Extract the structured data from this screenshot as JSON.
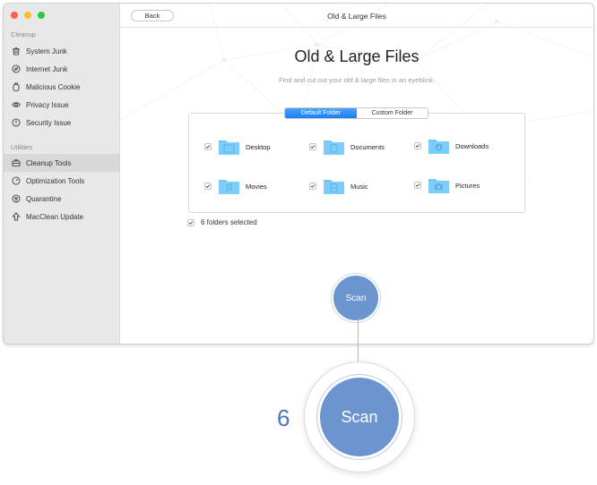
{
  "window": {
    "title": "Old & Large Files",
    "back_label": "Back"
  },
  "sidebar": {
    "sections": [
      {
        "label": "Cleanup",
        "items": [
          {
            "label": "System Junk",
            "icon": "trash-icon"
          },
          {
            "label": "Internet Junk",
            "icon": "compass-icon"
          },
          {
            "label": "Malicious Cookie",
            "icon": "cookie-jar-icon"
          },
          {
            "label": "Privacy Issue",
            "icon": "eye-icon"
          },
          {
            "label": "Security Issue",
            "icon": "shield-icon"
          }
        ]
      },
      {
        "label": "Utilities",
        "items": [
          {
            "label": "Cleanup Tools",
            "icon": "briefcase-icon",
            "active": true
          },
          {
            "label": "Optimization Tools",
            "icon": "gauge-icon"
          },
          {
            "label": "Quarantine",
            "icon": "biohazard-icon"
          },
          {
            "label": "MacClean Update",
            "icon": "arrow-up-icon"
          }
        ]
      }
    ]
  },
  "main": {
    "heading": "Old & Large Files",
    "subtitle": "Find and cut out your old & large files in an eyeblink.",
    "tabs": [
      {
        "label": "Default Folder",
        "active": true
      },
      {
        "label": "Custom Folder",
        "active": false
      }
    ],
    "folders": [
      {
        "label": "Desktop",
        "glyph": "desktop",
        "checked": true
      },
      {
        "label": "Documents",
        "glyph": "document",
        "checked": true
      },
      {
        "label": "Downloads",
        "glyph": "download",
        "checked": true
      },
      {
        "label": "Movies",
        "glyph": "music-note",
        "checked": true
      },
      {
        "label": "Music",
        "glyph": "film",
        "checked": true
      },
      {
        "label": "Pictures",
        "glyph": "camera",
        "checked": true
      }
    ],
    "selected_summary": "6 folders selected",
    "scan_label": "Scan"
  },
  "callout": {
    "step_number": "6",
    "scan_label": "Scan"
  },
  "colors": {
    "accent": "#1a7ff5",
    "scan_button": "#6c94cf",
    "folder": "#6cc4f8",
    "step_number": "#4a77c3"
  }
}
